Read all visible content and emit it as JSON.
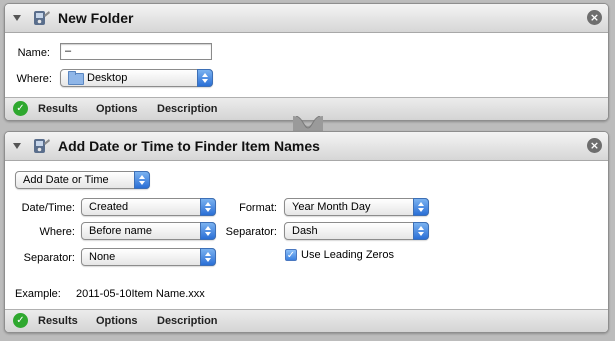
{
  "actions": [
    {
      "title": "New Folder",
      "fields": {
        "name_label": "Name:",
        "name_value": "–",
        "where_label": "Where:",
        "where_value": "Desktop"
      },
      "footer": {
        "results": "Results",
        "options": "Options",
        "description": "Description"
      }
    },
    {
      "title": "Add Date or Time to Finder Item Names",
      "fields": {
        "mode_value": "Add Date or Time",
        "datetime_label": "Date/Time:",
        "datetime_value": "Created",
        "where_label": "Where:",
        "where_value": "Before name",
        "separator_label": "Separator:",
        "separator_value": "None",
        "format_label": "Format:",
        "format_value": "Year Month Day",
        "separator2_label": "Separator:",
        "separator2_value": "Dash",
        "leading_zeros_label": "Use Leading Zeros",
        "leading_zeros_checked": true,
        "example_label": "Example:",
        "example_value": "2011-05-10Item Name.xxx"
      },
      "footer": {
        "results": "Results",
        "options": "Options",
        "description": "Description"
      }
    }
  ],
  "icons": {
    "close": "close-icon",
    "disclosure": "disclosure-triangle-icon",
    "app": "automator-icon",
    "results_status": "check-icon",
    "folder": "folder-icon"
  },
  "colors": {
    "background": "#bcbcbc",
    "status_green": "#2fa82f",
    "popup_accent": "#2a6fd6"
  }
}
